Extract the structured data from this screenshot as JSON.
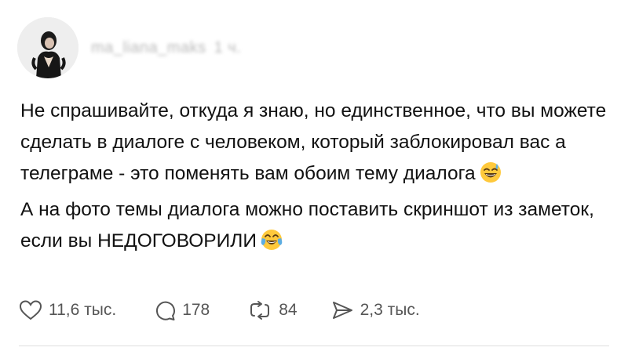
{
  "post": {
    "author": {
      "username": "ma_liana_maks",
      "time": "1 ч."
    },
    "paragraphs": [
      {
        "text": "Не спрашивайте, откуда я знаю, но единственное, что вы можете сделать в диалоге с человеком, который заблокировал вас а телеграме - это поменять вам обоим тему диалога",
        "emoji": "sweat-smile-emoji"
      },
      {
        "text": "А на фото темы диалога можно поставить скриншот из заметок, если вы НЕДОГОВОРИЛИ",
        "emoji": "tears-of-joy-emoji"
      }
    ],
    "stats": {
      "likes": "11,6 тыс.",
      "comments": "178",
      "reposts": "84",
      "shares": "2,3 тыс."
    }
  },
  "colors": {
    "text": "#111111",
    "muted": "#555555",
    "emoji_face": "#FFC93C",
    "emoji_tear": "#5DADE2"
  }
}
